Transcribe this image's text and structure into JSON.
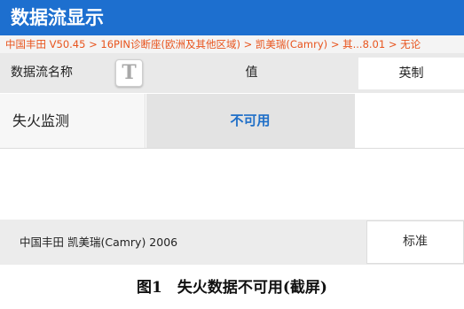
{
  "app": {
    "title": "数据流显示"
  },
  "breadcrumb": "中国丰田 V50.45 > 16PIN诊断座(欧洲及其他区域) > 凯美瑞(Camry) > 其...8.01 > 无论",
  "table": {
    "header_name": "数据流名称",
    "text_toggle_glyph": "T",
    "header_value": "值",
    "unit_label": "英制",
    "rows": [
      {
        "name": "失火监测",
        "value": "不可用",
        "unit": ""
      }
    ]
  },
  "footer": {
    "vehicle": "中国丰田 凯美瑞(Camry) 2006",
    "standard_button": "标准"
  },
  "caption": "图1　失火数据不可用(截屏)",
  "colors": {
    "titlebar": "#1d6fcf",
    "breadcrumb_text": "#e8541d",
    "value_text": "#1f6fc8"
  }
}
